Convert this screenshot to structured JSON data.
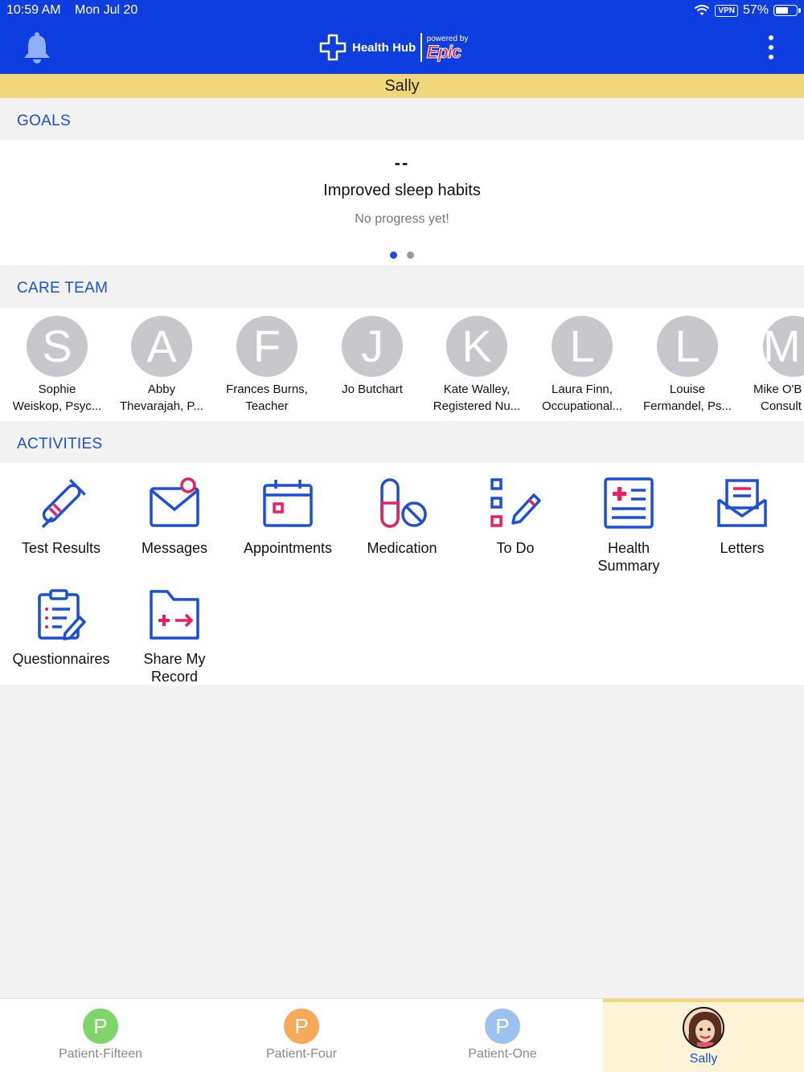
{
  "status_bar": {
    "time": "10:59 AM",
    "date": "Mon Jul 20",
    "vpn": "VPN",
    "battery": "57%"
  },
  "header": {
    "brand": "Health Hub",
    "powered_by": "powered by",
    "vendor": "Epic"
  },
  "patient_bar": {
    "name": "Sally"
  },
  "goals": {
    "title": "GOALS",
    "value": "--",
    "goal_name": "Improved sleep habits",
    "progress_text": "No progress yet!"
  },
  "care_team": {
    "title": "CARE TEAM",
    "members": [
      {
        "initial": "S",
        "line1": "Sophie",
        "line2": "Weiskop, Psyc..."
      },
      {
        "initial": "A",
        "line1": "Abby",
        "line2": "Thevarajah, P..."
      },
      {
        "initial": "F",
        "line1": "Frances Burns,",
        "line2": "Teacher"
      },
      {
        "initial": "J",
        "line1": "Jo Butchart",
        "line2": ""
      },
      {
        "initial": "K",
        "line1": "Kate Walley,",
        "line2": "Registered Nu..."
      },
      {
        "initial": "L",
        "line1": "Laura Finn,",
        "line2": "Occupational..."
      },
      {
        "initial": "L",
        "line1": "Louise",
        "line2": "Fermandel, Ps..."
      },
      {
        "initial": "M",
        "line1": "Mike O'B",
        "line2": "Consult"
      }
    ]
  },
  "activities": {
    "title": "ACTIVITIES",
    "items": [
      {
        "line1": "Test Results",
        "line2": ""
      },
      {
        "line1": "Messages",
        "line2": ""
      },
      {
        "line1": "Appointments",
        "line2": ""
      },
      {
        "line1": "Medication",
        "line2": ""
      },
      {
        "line1": "To Do",
        "line2": ""
      },
      {
        "line1": "Health",
        "line2": "Summary"
      },
      {
        "line1": "Letters",
        "line2": ""
      },
      {
        "line1": "Questionnaires",
        "line2": ""
      },
      {
        "line1": "Share My",
        "line2": "Record"
      }
    ]
  },
  "tabs": [
    {
      "initial": "P",
      "label": "Patient-Fifteen",
      "color": "#7ed66a"
    },
    {
      "initial": "P",
      "label": "Patient-Four",
      "color": "#f7a95a"
    },
    {
      "initial": "P",
      "label": "Patient-One",
      "color": "#9cc3f0"
    },
    {
      "initial": "",
      "label": "Sally",
      "color": "#f3c9a8"
    }
  ],
  "colors": {
    "header": "#0f3ee0",
    "accent": "#1c4fd8",
    "pink": "#e8205f",
    "patient_bar": "#efd77a"
  }
}
